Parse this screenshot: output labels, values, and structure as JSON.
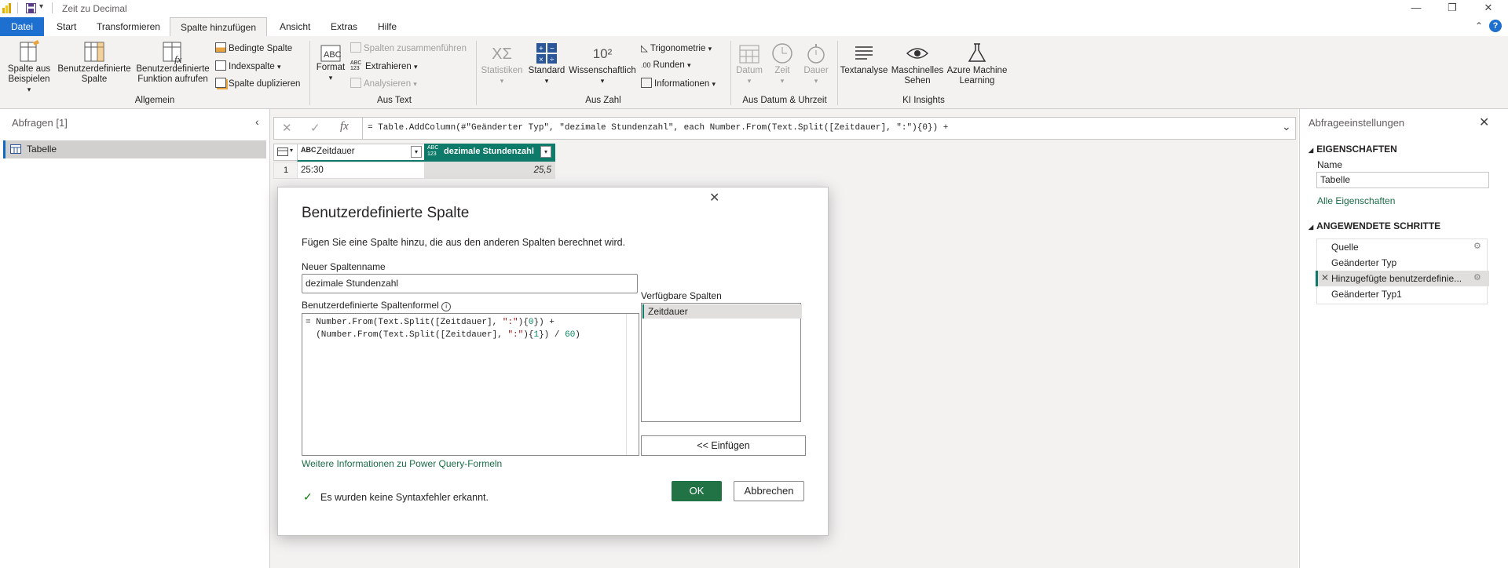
{
  "window": {
    "title": "Zeit zu Decimal"
  },
  "tabs": [
    "Datei",
    "Start",
    "Transformieren",
    "Spalte hinzufügen",
    "Ansicht",
    "Extras",
    "Hilfe"
  ],
  "ribbon": {
    "allgemein": {
      "spalte_aus_beispielen": "Spalte aus Beispielen",
      "benutzerdefinierte_spalte": "Benutzerdefinierte Spalte",
      "funktion_aufrufen": "Benutzerdefinierte Funktion aufrufen",
      "bedingte_spalte": "Bedingte Spalte",
      "indexspalte": "Indexspalte",
      "spalte_duplizieren": "Spalte duplizieren",
      "label": "Allgemein"
    },
    "aus_text": {
      "format": "Format",
      "spalten_zusammenfuehren": "Spalten zusammenführen",
      "extrahieren": "Extrahieren",
      "analysieren": "Analysieren",
      "label": "Aus Text"
    },
    "aus_zahl": {
      "statistiken": "Statistiken",
      "standard": "Standard",
      "wissenschaftlich": "Wissenschaftlich",
      "trigonometrie": "Trigonometrie",
      "runden": "Runden",
      "informationen": "Informationen",
      "label": "Aus Zahl"
    },
    "aus_datum": {
      "datum": "Datum",
      "zeit": "Zeit",
      "dauer": "Dauer",
      "label": "Aus Datum & Uhrzeit"
    },
    "ki": {
      "textanalyse": "Textanalyse",
      "maschinelles_sehen": "Maschinelles Sehen",
      "azure_ml": "Azure Machine Learning",
      "label": "KI Insights"
    }
  },
  "queries": {
    "title": "Abfragen [1]",
    "items": [
      "Tabelle"
    ]
  },
  "formula_bar": {
    "text": "= Table.AddColumn(#\"Geänderter Typ\", \"dezimale Stundenzahl\", each Number.From(Text.Split([Zeitdauer], \":\"){0}) +"
  },
  "grid": {
    "columns": [
      {
        "type": "ABC",
        "name": "Zeitdauer"
      },
      {
        "type": "ABC 123",
        "name": "dezimale Stundenzahl"
      }
    ],
    "rows": [
      {
        "index": "1",
        "cells": [
          "25:30",
          "25,5"
        ]
      }
    ]
  },
  "settings": {
    "title": "Abfrageeinstellungen",
    "properties_header": "EIGENSCHAFTEN",
    "name_label": "Name",
    "name_value": "Tabelle",
    "all_properties_link": "Alle Eigenschaften",
    "steps_header": "ANGEWENDETE SCHRITTE",
    "steps": [
      "Quelle",
      "Geänderter Typ",
      "Hinzugefügte benutzerdefinie...",
      "Geänderter Typ1"
    ]
  },
  "dialog": {
    "title": "Benutzerdefinierte Spalte",
    "description": "Fügen Sie eine Spalte hinzu, die aus den anderen Spalten berechnet wird.",
    "name_label": "Neuer Spaltenname",
    "name_value": "dezimale Stundenzahl",
    "formula_label": "Benutzerdefinierte Spaltenformel",
    "formula_line1_a": "= Number.From(Text.Split([Zeitdauer], ",
    "formula_line1_str": "\":\"",
    "formula_line1_b": "){",
    "formula_line1_num": "0",
    "formula_line1_c": "}) +",
    "formula_line2_a": "  (Number.From(Text.Split([Zeitdauer], ",
    "formula_line2_str": "\":\"",
    "formula_line2_b": "){",
    "formula_line2_num": "1",
    "formula_line2_c": "}) / ",
    "formula_line2_num2": "60",
    "formula_line2_d": ")",
    "available_label": "Verfügbare Spalten",
    "available_columns": [
      "Zeitdauer"
    ],
    "insert_button": "<< Einfügen",
    "help_link": "Weitere Informationen zu Power Query-Formeln",
    "status_text": "Es wurden keine Syntaxfehler erkannt.",
    "ok_button": "OK",
    "cancel_button": "Abbrechen"
  },
  "colors": {
    "accent": "#217346",
    "teal": "#0d7a6a",
    "link": "#1a6d46"
  }
}
